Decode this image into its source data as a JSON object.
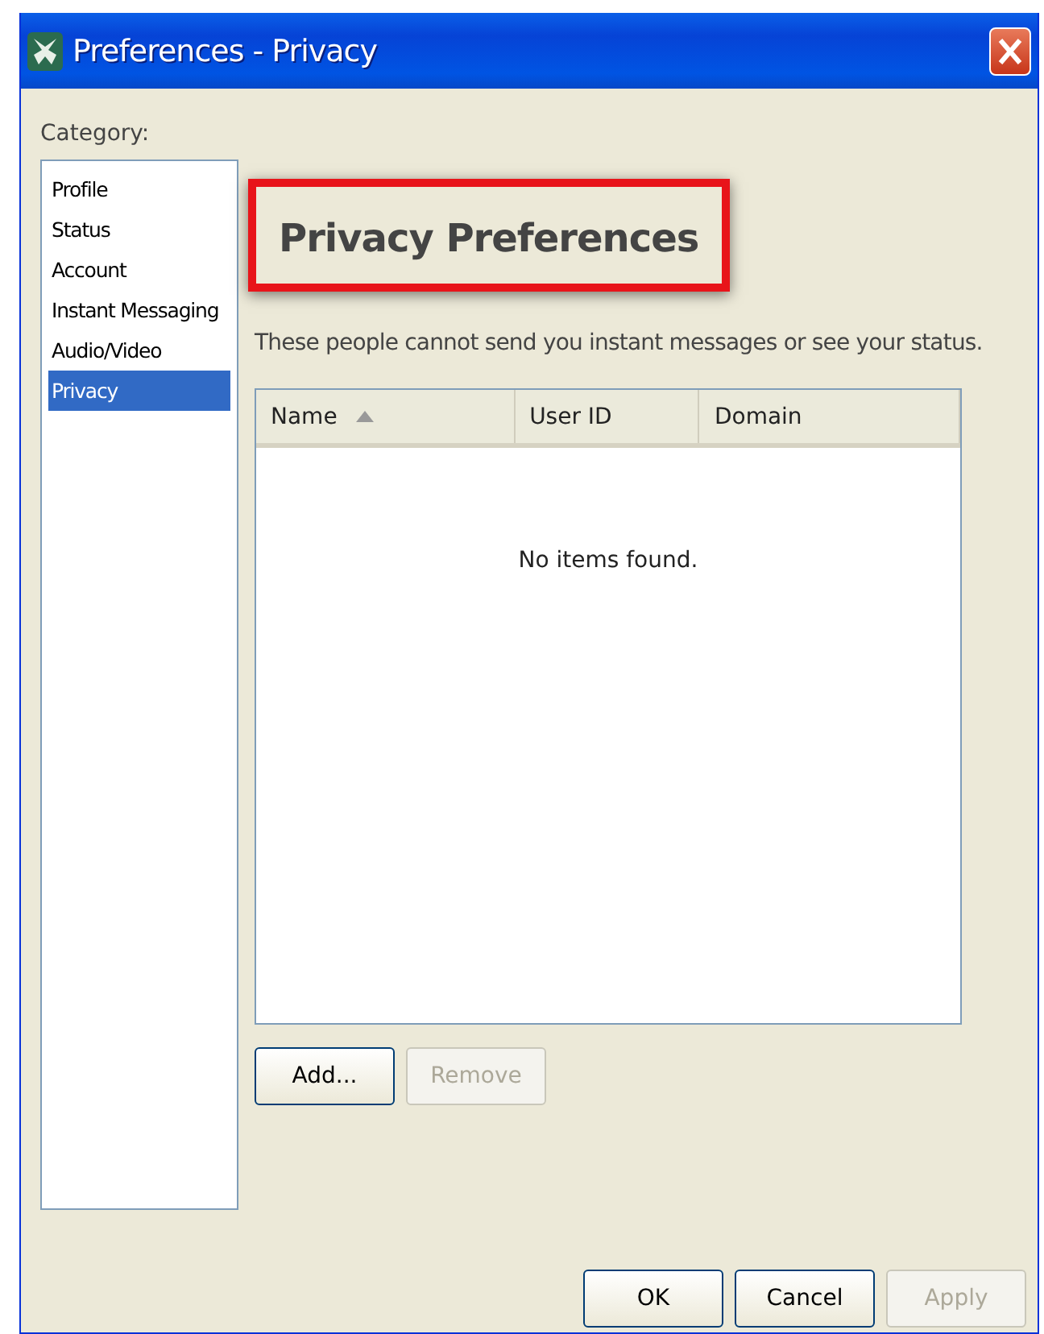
{
  "window": {
    "title": "Preferences - Privacy"
  },
  "category": {
    "label": "Category:",
    "items": [
      {
        "label": "Profile",
        "selected": false
      },
      {
        "label": "Status",
        "selected": false
      },
      {
        "label": "Account",
        "selected": false
      },
      {
        "label": "Instant Messaging",
        "selected": false
      },
      {
        "label": "Audio/Video",
        "selected": false
      },
      {
        "label": "Privacy",
        "selected": true
      }
    ]
  },
  "heading": "Privacy Preferences",
  "description": "These people cannot send you instant messages or see your status.",
  "table": {
    "columns": [
      {
        "label": "Name",
        "sorted": true
      },
      {
        "label": "User ID",
        "sorted": false
      },
      {
        "label": "Domain",
        "sorted": false
      }
    ],
    "empty_text": "No items found."
  },
  "list_buttons": [
    {
      "label": "Add...",
      "disabled": false
    },
    {
      "label": "Remove",
      "disabled": true
    }
  ],
  "dialog_buttons": [
    {
      "label": "OK",
      "disabled": false
    },
    {
      "label": "Cancel",
      "disabled": false
    },
    {
      "label": "Apply",
      "disabled": true
    }
  ]
}
